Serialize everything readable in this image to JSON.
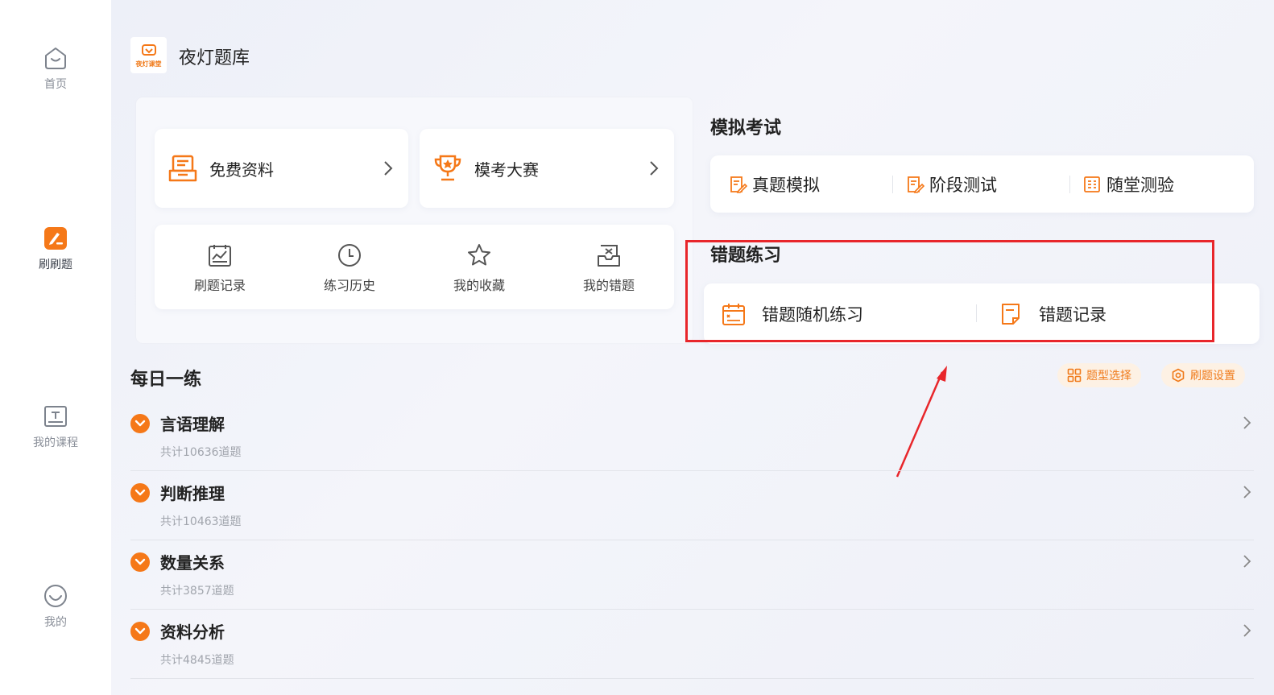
{
  "sidebar": {
    "items": [
      {
        "label": "首页",
        "icon": "home-icon"
      },
      {
        "label": "刷刷题",
        "icon": "practice-icon"
      },
      {
        "label": "我的课程",
        "icon": "course-icon"
      },
      {
        "label": "我的",
        "icon": "profile-icon"
      }
    ],
    "active": "刷刷题"
  },
  "header": {
    "title": "夜灯题库",
    "logo_text": "夜灯课堂"
  },
  "left_panel": {
    "cards": [
      {
        "label": "免费资料",
        "icon": "document-tray-icon"
      },
      {
        "label": "模考大赛",
        "icon": "trophy-icon"
      }
    ],
    "quick": [
      {
        "label": "刷题记录",
        "icon": "chart-record-icon"
      },
      {
        "label": "练习历史",
        "icon": "clock-icon"
      },
      {
        "label": "我的收藏",
        "icon": "star-icon"
      },
      {
        "label": "我的错题",
        "icon": "inbox-x-icon"
      }
    ]
  },
  "mock_exam": {
    "title": "模拟考试",
    "items": [
      {
        "label": "真题模拟",
        "icon": "exam-paper-icon"
      },
      {
        "label": "阶段测试",
        "icon": "exam-paper-icon"
      },
      {
        "label": "随堂测验",
        "icon": "checklist-icon"
      }
    ]
  },
  "wrong_practice": {
    "title": "错题练习",
    "items": [
      {
        "label": "错题随机练习",
        "icon": "calendar-icon"
      },
      {
        "label": "错题记录",
        "icon": "note-icon"
      }
    ]
  },
  "daily": {
    "title": "每日一练",
    "buttons": [
      {
        "label": "题型选择",
        "icon": "grid-icon"
      },
      {
        "label": "刷题设置",
        "icon": "hexagon-settings-icon"
      }
    ],
    "categories": [
      {
        "name": "言语理解",
        "count": "共计10636道题"
      },
      {
        "name": "判断推理",
        "count": "共计10463道题"
      },
      {
        "name": "数量关系",
        "count": "共计3857道题"
      },
      {
        "name": "资料分析",
        "count": "共计4845道题"
      }
    ]
  },
  "colors": {
    "accent": "#f57818",
    "highlight": "#e8262b",
    "text": "#222222",
    "muted": "#a1a5ad"
  }
}
